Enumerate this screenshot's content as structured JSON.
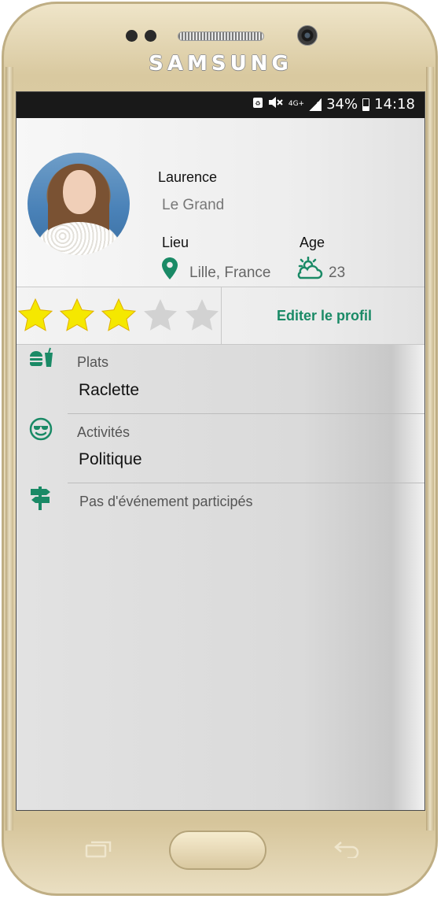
{
  "device": {
    "brand": "SAMSUNG"
  },
  "status_bar": {
    "network": "4G+",
    "battery_percent": "34%",
    "time": "14:18"
  },
  "profile": {
    "first_name": "Laurence",
    "last_name": "Le Grand",
    "lieu_label": "Lieu",
    "lieu_value": "Lille, France",
    "age_label": "Age",
    "age_value": "23"
  },
  "rating": {
    "value": 3,
    "max": 5,
    "filled_color": "#f5e800",
    "empty_color": "#d2d2d2"
  },
  "actions": {
    "edit_profile_label": "Editer le profil"
  },
  "details": {
    "plats_label": "Plats",
    "plats_value": "Raclette",
    "activites_label": "Activités",
    "activites_value": "Politique",
    "events_text": "Pas d'événement participés"
  },
  "colors": {
    "accent": "#1a8a66",
    "status_bar": "#191919"
  },
  "icons": [
    "location-pin-icon",
    "weather-partly-sunny-icon",
    "food-icon",
    "cool-face-icon",
    "signpost-icon"
  ]
}
